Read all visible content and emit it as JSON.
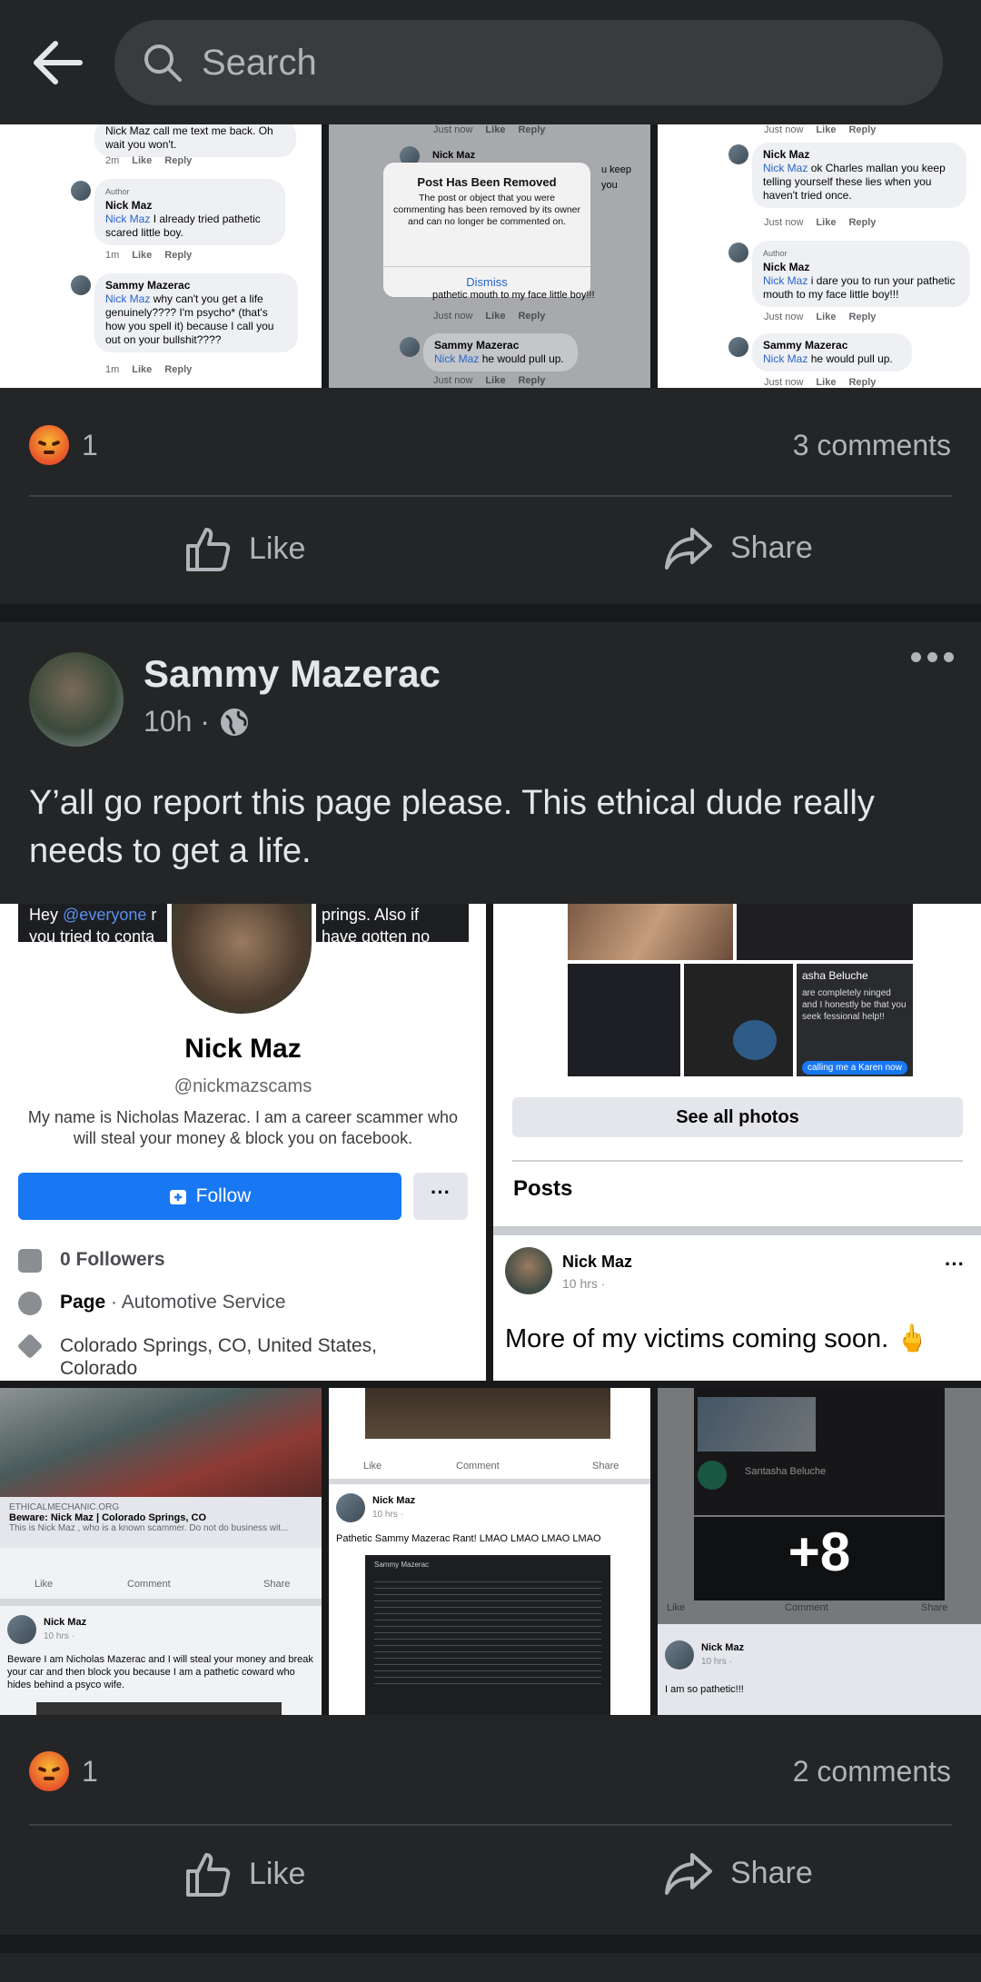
{
  "search": {
    "placeholder": "Search"
  },
  "post1": {
    "reaction_count": "1",
    "comments": "3 comments",
    "like_label": "Like",
    "share_label": "Share",
    "thumb1": {
      "c1_text": "Nick Maz call me text me back. Oh wait you won't.",
      "c1_meta_time": "2m",
      "author_badge": "Author",
      "c2_name": "Nick Maz",
      "c2_mention": "Nick Maz",
      "c2_text": "I already tried pathetic scared little boy.",
      "c2_meta_time": "1m",
      "c3_name": "Sammy Mazerac",
      "c3_mention": "Nick Maz",
      "c3_text": "why can't you get a life genuinely???? I'm psycho* (that's how you spell it) because I call you out on your bullshit????",
      "c3_meta_time": "1m",
      "like": "Like",
      "reply": "Reply"
    },
    "thumb2": {
      "top_meta": "Just now",
      "name": "Nick Maz",
      "dialog_title": "Post Has Been Removed",
      "dialog_body": "The post or object that you were commenting has been removed by its owner and can no longer be commented on.",
      "dismiss": "Dismiss",
      "partial1": "u keep",
      "partial2": "you",
      "partial3": "pathetic mouth to my face little boy!!!",
      "meta2": "Just now",
      "c_name": "Sammy Mazerac",
      "c_mention": "Nick Maz",
      "c_text": "he would pull up.",
      "meta3": "Just now"
    },
    "thumb3": {
      "top_meta": "Just now",
      "c1_name": "Nick Maz",
      "c1_mention": "Nick Maz",
      "c1_text": "ok Charles mallan you keep telling yourself these lies when you haven't tried once.",
      "c1_meta": "Just now",
      "author_badge": "Author",
      "c2_name": "Nick Maz",
      "c2_mention": "Nick Maz",
      "c2_text": "i dare you to run your pathetic mouth to my face little boy!!!",
      "c2_meta": "Just now",
      "c3_name": "Sammy Mazerac",
      "c3_mention": "Nick Maz",
      "c3_text": "he would pull up.",
      "c3_meta": "Just now"
    }
  },
  "post2": {
    "author": "Sammy Mazerac",
    "time": "10h ·",
    "text": "Y’all go report this page please. This ethical dude really needs to get a life.",
    "reaction_count": "1",
    "comments": "2 comments",
    "like_label": "Like",
    "share_label": "Share",
    "profile": {
      "banner_prefix": "Hey",
      "banner_mention": "@everyone",
      "banner_mid": "r",
      "banner_right": "prings. Also if",
      "banner_line2_left": "you tried to conta",
      "banner_line2_right": "have gotten no",
      "name": "Nick Maz",
      "handle": "@nickmazscams",
      "bio": "My name is Nicholas Mazerac. I am a career scammer who will steal your money & block you on facebook.",
      "follow": "Follow",
      "more": "···",
      "followers": "0 Followers",
      "page_bold": "Page",
      "page_type": " · Automotive Service",
      "location": "Colorado Springs, CO, United States, Colorado"
    },
    "photos": {
      "see_all": "See all photos",
      "posts_heading": "Posts",
      "np_name": "Nick Maz",
      "np_time": "10 hrs ·",
      "np_text": "More of my victims coming soon. 🖕",
      "np_dots": "···",
      "tile_name": "asha Beluche",
      "tile_text": "are completely ninged and I honestly be that you seek fessional help!!",
      "tile_bubble": "calling me a Karen now"
    },
    "bottom": {
      "b1_site": "ETHICALMECHANIC.ORG",
      "b1_title": "Beware: Nick Maz | Colorado Springs, CO",
      "b1_desc": "This is Nick Maz , who is a known scammer. Do not do business wit...",
      "like": "Like",
      "comment": "Comment",
      "share": "Share",
      "b1_name": "Nick Maz",
      "b1_time": "10 hrs ·",
      "b1_text": "Beware I am Nicholas Mazerac and I will steal your money and break your car and then block you because I am a pathetic coward who hides behind a psyco wife.",
      "b2_name": "Nick Maz",
      "b2_time": "10 hrs ·",
      "b2_text": "Pathetic Sammy Mazerac Rant! LMAO LMAO LMAO LMAO",
      "b2_inner_name": "Sammy Mazerac",
      "b3_name": "Santasha Beluche",
      "b3_more": "+8",
      "b3_bottom_name": "Nick Maz",
      "b3_bottom_time": "10 hrs ·",
      "b3_bottom_text": "I am so pathetic!!!"
    }
  }
}
